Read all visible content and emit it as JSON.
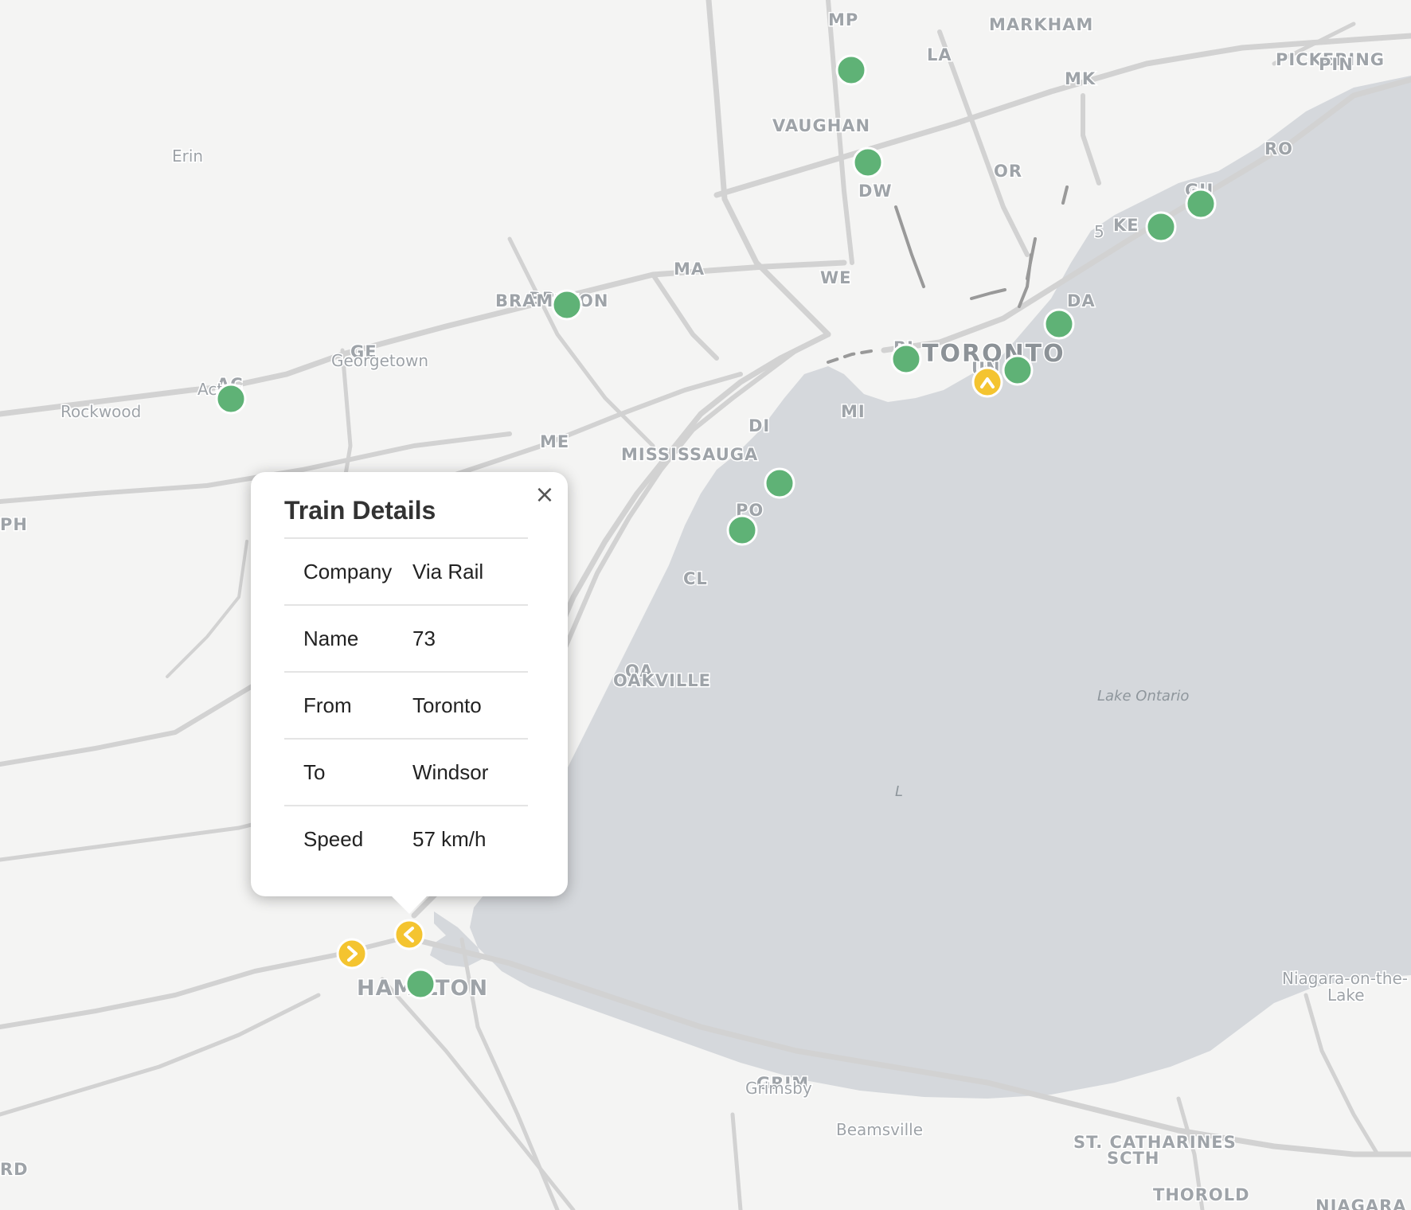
{
  "map": {
    "places": {
      "mp": "MP",
      "markham": "MARKHAM",
      "la": "LA",
      "mk": "MK",
      "pickering": "PICKERING",
      "pin": "PIN",
      "vaughan": "VAUGHAN",
      "ro": "RO",
      "or": "OR",
      "dw": "DW",
      "gu": "GU",
      "ke": "KE",
      "hwy5": "5",
      "erin": "Erin",
      "ma": "MA",
      "we": "WE",
      "br": "BR",
      "brampton": "BRAMPTON",
      "da": "DA",
      "ge": "GE",
      "georgetown": "Georgetown",
      "bl": "BL",
      "toronto": "TORONTO",
      "un": "UN",
      "ac": "AC",
      "acton": "Acton",
      "rockwood": "Rockwood",
      "mi": "MI",
      "di": "DI",
      "me": "ME",
      "mississauga": "MISSISSAUGA",
      "ph": "PH",
      "po": "PO",
      "cl": "CL",
      "oa": "OA",
      "oakville": "OAKVILLE",
      "lake_ontario": "Lake Ontario",
      "l_marker": "L",
      "hamilton": "HAMILTON",
      "niagara_otl_1": "Niagara-on-the-",
      "niagara_otl_2": "Lake",
      "grim": "GRIM",
      "grimsby": "Grimsby",
      "beamsville": "Beamsville",
      "st_catharines": "ST. CATHARINES",
      "scth": "SCTH",
      "thorold": "THOROLD",
      "rd": "RD",
      "niagara": "NIAGARA"
    },
    "colors": {
      "land": "#f4f4f3",
      "water": "#d5d8dc",
      "road": "#d2d2d2",
      "rail": "#999999",
      "station_marker": "#5fb276",
      "train_marker": "#f4c430"
    },
    "station_marker_count": 16,
    "train_marker_icons": [
      "chevron-up-icon",
      "chevron-left-icon",
      "chevron-right-icon"
    ]
  },
  "popup": {
    "title": "Train Details",
    "close_symbol": "×",
    "rows": [
      {
        "key": "Company",
        "value": "Via Rail"
      },
      {
        "key": "Name",
        "value": "73"
      },
      {
        "key": "From",
        "value": "Toronto"
      },
      {
        "key": "To",
        "value": "Windsor"
      },
      {
        "key": "Speed",
        "value": "57 km/h"
      }
    ]
  }
}
